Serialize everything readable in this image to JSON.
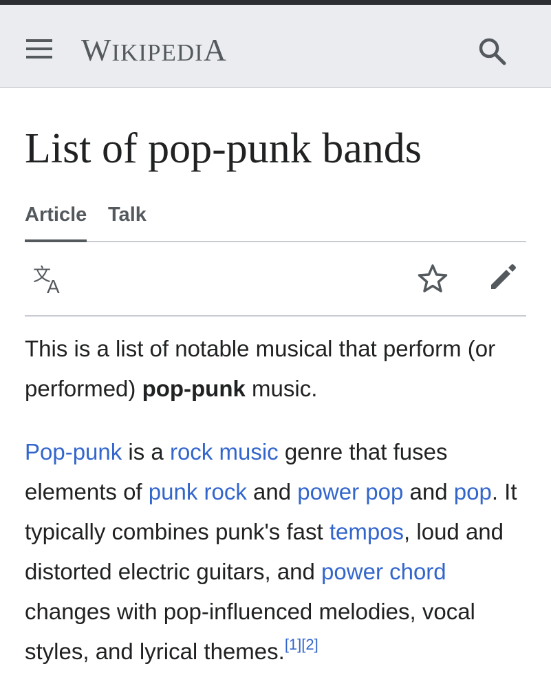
{
  "header": {
    "wordmark_first": "W",
    "wordmark_rest": "IKIPEDI",
    "wordmark_last": "A",
    "menu_icon": "hamburger-menu-icon",
    "search_icon": "search-icon",
    "background": "#eaecf0"
  },
  "page": {
    "title": "List of pop-punk bands"
  },
  "tabs": [
    {
      "label": "Article",
      "selected": true
    },
    {
      "label": "Talk",
      "selected": false
    }
  ],
  "actions": {
    "language_icon": "language-icon",
    "watch_icon": "star-icon",
    "edit_icon": "pencil-edit-icon"
  },
  "intro": {
    "text_before": "This is a list of notable musical that perform (or performed) ",
    "bold": "pop-punk",
    "text_after": " music."
  },
  "paragraph": {
    "link_pop_punk": "Pop-punk",
    "t1": " is a ",
    "link_rock_music": "rock music",
    "t2": " genre that fuses elements of ",
    "link_punk_rock": "punk rock",
    "t3": " and ",
    "link_power_pop": "power pop",
    "t4": " and ",
    "link_pop": "pop",
    "t5": ". It typically combines punk's fast ",
    "link_tempos": "tempos",
    "t6": ", loud and distorted electric guitars, and ",
    "link_power_chord": "power chord",
    "t7": " changes with pop-influenced melodies, vocal styles, and lyrical themes.",
    "ref1": "[1]",
    "ref2": "[2]"
  },
  "colors": {
    "link": "#3366cc",
    "text": "#202122",
    "icon": "#54595d"
  }
}
